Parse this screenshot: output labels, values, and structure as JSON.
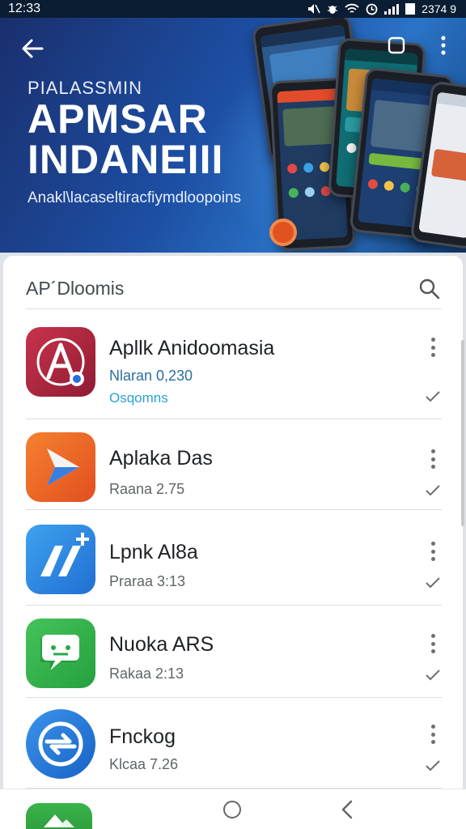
{
  "status_bar": {
    "time": "12:33",
    "right_text": "2374 9",
    "icons": [
      "mute-icon",
      "bug-icon",
      "wifi-icon",
      "alarm-icon",
      "signal-icon",
      "battery-icon"
    ]
  },
  "hero": {
    "kicker": "PIALASSMIN",
    "title_line1": "APMSAR",
    "title_line2": "INDANEIII",
    "subtitle": "Anakl\\lacaseltiracfiymdloopoins"
  },
  "list_header": {
    "title": "AP´Dloomis"
  },
  "apps": [
    {
      "name": "Apllk Anidoomasia",
      "meta": "Nlaran 0,230",
      "meta2": "Osqomns",
      "icon": "a-logo-icon",
      "icon_color": "#b8263d"
    },
    {
      "name": "Aplaka Das",
      "meta": "Raana 2.75",
      "meta2": "",
      "icon": "play-arrow-icon",
      "icon_color": "#f0642a"
    },
    {
      "name": "Lpnk Al8a",
      "meta": "Praraa 3:13",
      "meta2": "",
      "icon": "n-plus-icon",
      "icon_color": "#2d8be0"
    },
    {
      "name": "Nuoka ARS",
      "meta": "Rakaa 2:13",
      "meta2": "",
      "icon": "chat-face-icon",
      "icon_color": "#34b64a"
    },
    {
      "name": "Fnckog",
      "meta": "Klcaa 7.26",
      "meta2": "",
      "icon": "sync-arrows-icon",
      "icon_color": "#1f7ed8"
    }
  ],
  "colors": {
    "hero_bg": "#1d4fa4",
    "meta_accent": "#2aa0d8",
    "status_bar": "#0b1d33"
  }
}
